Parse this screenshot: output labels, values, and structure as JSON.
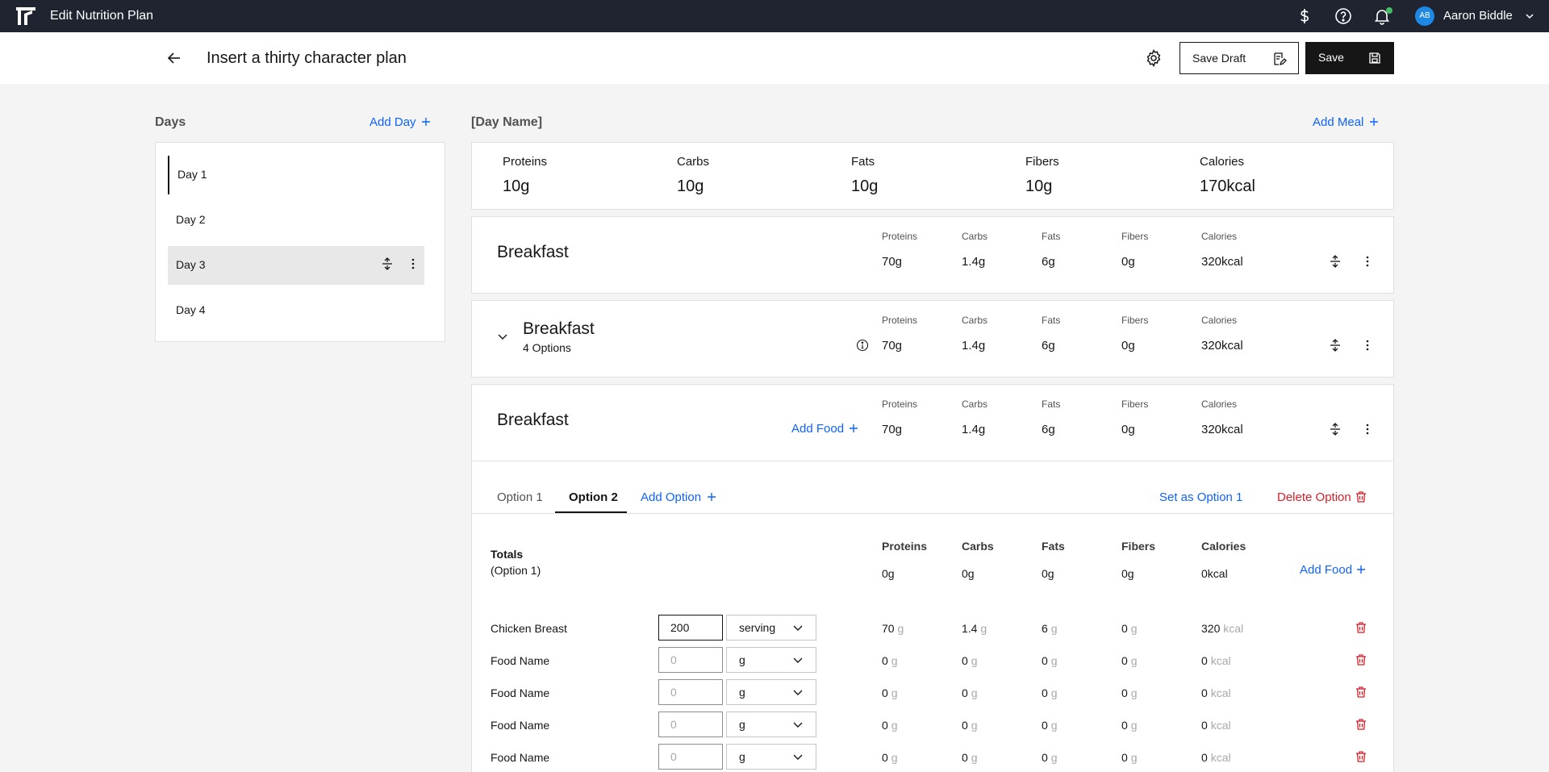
{
  "topbar": {
    "title": "Edit Nutrition Plan",
    "user_initials": "AB",
    "user_name": "Aaron Biddle"
  },
  "header": {
    "plan_title": "Insert a thirty character plan",
    "save_draft": "Save Draft",
    "save": "Save"
  },
  "days": {
    "heading": "Days",
    "add_day": "Add Day",
    "items": [
      {
        "label": "Day 1"
      },
      {
        "label": "Day 2"
      },
      {
        "label": "Day 3"
      },
      {
        "label": "Day 4"
      }
    ]
  },
  "day_panel": {
    "heading": "[Day Name]",
    "add_meal": "Add Meal",
    "summary": [
      {
        "label": "Proteins",
        "value": "10g"
      },
      {
        "label": "Carbs",
        "value": "10g"
      },
      {
        "label": "Fats",
        "value": "10g"
      },
      {
        "label": "Fibers",
        "value": "10g"
      },
      {
        "label": "Calories",
        "value": "170kcal"
      }
    ]
  },
  "macro_labels": [
    "Proteins",
    "Carbs",
    "Fats",
    "Fibers",
    "Calories"
  ],
  "meals": [
    {
      "name": "Breakfast",
      "values": [
        "70g",
        "1.4g",
        "6g",
        "0g",
        "320kcal"
      ]
    },
    {
      "name": "Breakfast",
      "subtitle": "4 Options",
      "values": [
        "70g",
        "1.4g",
        "6g",
        "0g",
        "320kcal"
      ]
    },
    {
      "name": "Breakfast",
      "add_food": "Add Food",
      "values": [
        "70g",
        "1.4g",
        "6g",
        "0g",
        "320kcal"
      ]
    }
  ],
  "option_tabs": {
    "tabs": [
      "Option 1",
      "Option 2"
    ],
    "active": "Option 2",
    "add_option": "Add Option",
    "set_as": "Set as Option 1",
    "delete": "Delete Option"
  },
  "totals": {
    "title": "Totals",
    "subtitle": "(Option 1)",
    "headers": [
      "Proteins",
      "Carbs",
      "Fats",
      "Fibers",
      "Calories"
    ],
    "values": [
      "0g",
      "0g",
      "0g",
      "0g",
      "0kcal"
    ],
    "add_food": "Add Food"
  },
  "foods": [
    {
      "name": "Chicken Breast",
      "qty": "200",
      "unit": "serving",
      "vals": [
        "70",
        "1.4",
        "6",
        "0",
        "320"
      ],
      "units": [
        "g",
        "g",
        "g",
        "g",
        "kcal"
      ]
    },
    {
      "name": "Food Name",
      "qty_placeholder": "0",
      "unit": "g",
      "vals": [
        "0",
        "0",
        "0",
        "0",
        "0"
      ],
      "units": [
        "g",
        "g",
        "g",
        "g",
        "kcal"
      ]
    },
    {
      "name": "Food Name",
      "qty_placeholder": "0",
      "unit": "g",
      "vals": [
        "0",
        "0",
        "0",
        "0",
        "0"
      ],
      "units": [
        "g",
        "g",
        "g",
        "g",
        "kcal"
      ]
    },
    {
      "name": "Food Name",
      "qty_placeholder": "0",
      "unit": "g",
      "vals": [
        "0",
        "0",
        "0",
        "0",
        "0"
      ],
      "units": [
        "g",
        "g",
        "g",
        "g",
        "kcal"
      ]
    },
    {
      "name": "Food Name",
      "qty_placeholder": "0",
      "unit": "g",
      "vals": [
        "0",
        "0",
        "0",
        "0",
        "0"
      ],
      "units": [
        "g",
        "g",
        "g",
        "g",
        "kcal"
      ]
    }
  ]
}
